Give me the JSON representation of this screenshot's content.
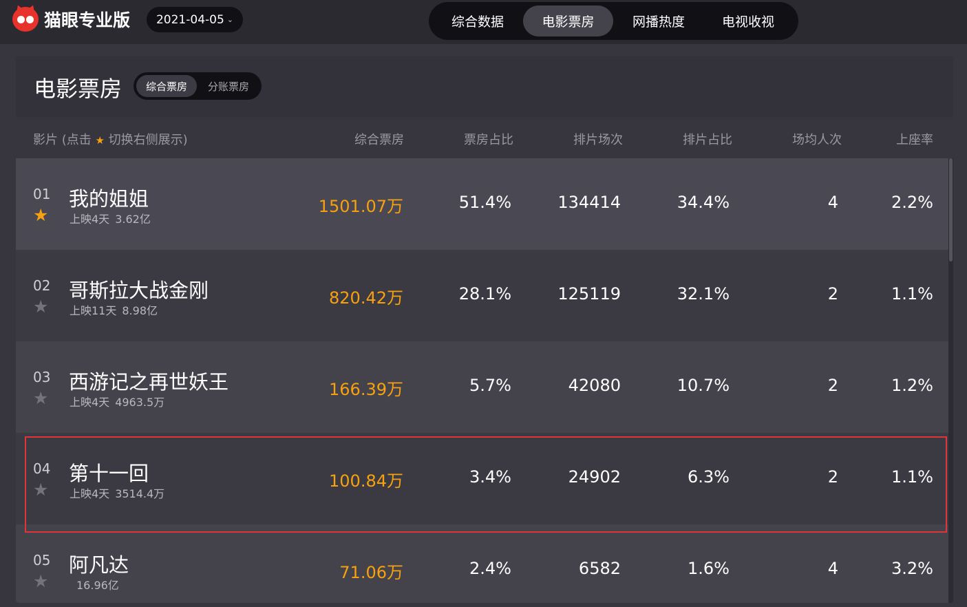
{
  "app": {
    "brand": "猫眼专业版",
    "date": "2021-04-05",
    "nav_tabs": [
      "综合数据",
      "电影票房",
      "网播热度",
      "电视收视"
    ],
    "active_nav": "电影票房"
  },
  "panel": {
    "title": "电影票房",
    "subtabs": [
      "综合票房",
      "分账票房"
    ],
    "active_subtab": "综合票房"
  },
  "table": {
    "headers": {
      "film_prefix": "影片 (点击",
      "film_suffix": "切换右侧展示)",
      "box_office": "综合票房",
      "box_share": "票房占比",
      "screenings": "排片场次",
      "screen_share": "排片占比",
      "avg_attendance": "场均人次",
      "occupancy": "上座率"
    },
    "rows": [
      {
        "rank": "01",
        "starred": true,
        "name": "我的姐姐",
        "days": "上映4天",
        "total": "3.62亿",
        "box_office": "1501.07万",
        "box_share": "51.4%",
        "screenings": "134414",
        "screen_share": "34.4%",
        "avg_attendance": "4",
        "occupancy": "2.2%"
      },
      {
        "rank": "02",
        "starred": false,
        "name": "哥斯拉大战金刚",
        "days": "上映11天",
        "total": "8.98亿",
        "box_office": "820.42万",
        "box_share": "28.1%",
        "screenings": "125119",
        "screen_share": "32.1%",
        "avg_attendance": "2",
        "occupancy": "1.1%"
      },
      {
        "rank": "03",
        "starred": false,
        "name": "西游记之再世妖王",
        "days": "上映4天",
        "total": "4963.5万",
        "box_office": "166.39万",
        "box_share": "5.7%",
        "screenings": "42080",
        "screen_share": "10.7%",
        "avg_attendance": "2",
        "occupancy": "1.2%"
      },
      {
        "rank": "04",
        "starred": false,
        "name": "第十一回",
        "days": "上映4天",
        "total": "3514.4万",
        "box_office": "100.84万",
        "box_share": "3.4%",
        "screenings": "24902",
        "screen_share": "6.3%",
        "avg_attendance": "2",
        "occupancy": "1.1%"
      },
      {
        "rank": "05",
        "starred": false,
        "name": "阿凡达",
        "days": "",
        "total": "16.96亿",
        "box_office": "71.06万",
        "box_share": "2.4%",
        "screenings": "6582",
        "screen_share": "1.6%",
        "avg_attendance": "4",
        "occupancy": "3.2%"
      }
    ]
  },
  "colors": {
    "accent_orange": "#f7a10f",
    "highlight_red": "#e0353a",
    "brand_red": "#e8332c"
  },
  "icons": {
    "star": "★",
    "chevron": "⌄"
  }
}
